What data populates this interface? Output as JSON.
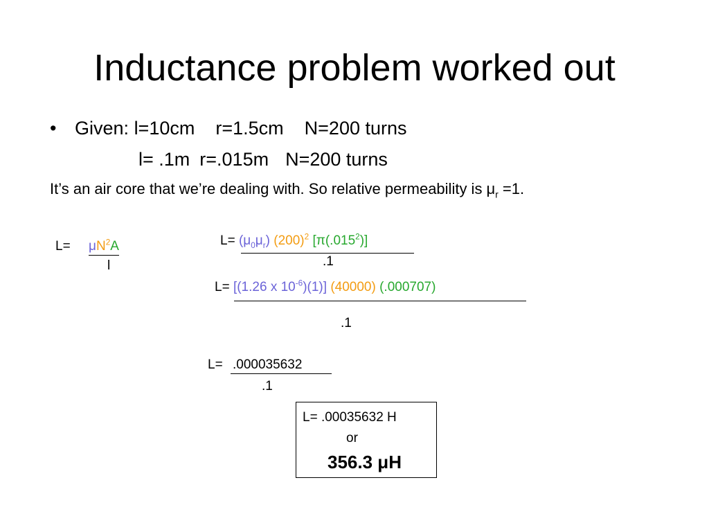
{
  "slide": {
    "title": "Inductance problem worked out",
    "bullet_symbol": "•",
    "given": {
      "label": "Given:",
      "length": "l=10cm",
      "radius": "r=1.5cm",
      "turns": "N=200 turns"
    },
    "given_si": {
      "length": "l= .1m",
      "radius": "r=.015m",
      "turns": "N=200 turns"
    },
    "air_core": {
      "text_before": "It’s an air core that we’re dealing with. So relative permeability is μ",
      "sub": "r",
      "text_after": " =1."
    }
  },
  "formula": {
    "lhs": "L=",
    "mu": "μ",
    "n": "N",
    "n_exp": "2",
    "a": "A",
    "denominator": "l"
  },
  "step1": {
    "lhs": "L=",
    "mu0": "(μ",
    "mu0_sub": "0",
    "mur": "μ",
    "mur_sub": "r",
    "mu_close": ")",
    "turns": "(200)",
    "turns_exp": "2",
    "area_open": "[π(.015",
    "area_exp": "2",
    "area_close": ")]",
    "denominator": ".1"
  },
  "step2": {
    "lhs": "L=",
    "mu_open": "[(1.26 x 10",
    "mu_exp": "-6",
    "mu_close": ")(1)]",
    "turns": "(40000)",
    "area": "(.000707)",
    "denominator": ".1"
  },
  "step3": {
    "lhs": "L=",
    "numerator": ".000035632",
    "denominator": ".1"
  },
  "answer": {
    "henry": "L= .00035632 H",
    "or": "or",
    "microhenry": "356.3 μH"
  },
  "colors": {
    "mu": "#6b63d8",
    "n_squared": "#f39c12",
    "area": "#27a82e",
    "text": "#000000"
  }
}
